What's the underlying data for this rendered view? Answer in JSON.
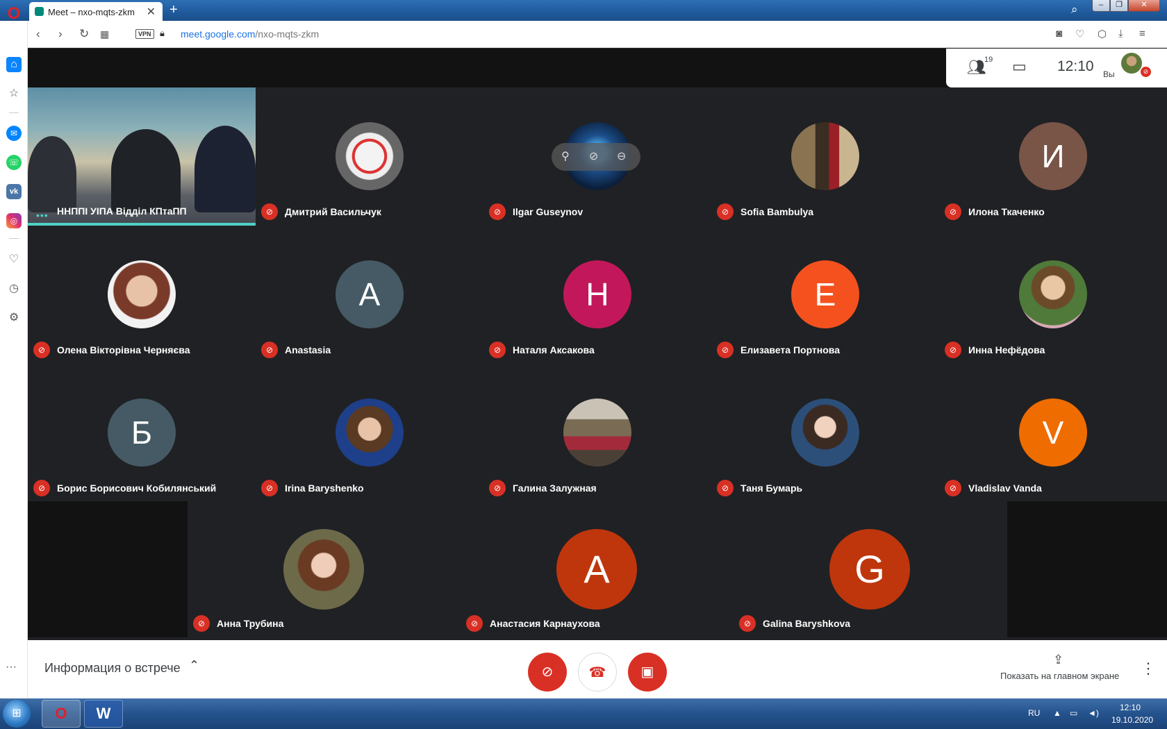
{
  "browser": {
    "tab_title": "Meet – nxo-mqts-zkm",
    "tab_close": "✕",
    "new_tab": "+",
    "url_host": "meet.google.com",
    "url_path": "/nxo-mqts-zkm",
    "vpn": "VPN"
  },
  "meet": {
    "people_count": "19",
    "clock": "12:10",
    "you_label": "Вы",
    "participants": [
      {
        "name": "ННППІ УІПА Відділ КПтаПП",
        "initial": "",
        "color": ""
      },
      {
        "name": "Дмитрий Васильчук",
        "initial": "",
        "color": ""
      },
      {
        "name": "Ilgar Guseynov",
        "initial": "",
        "color": ""
      },
      {
        "name": "Sofia Bambulya",
        "initial": "",
        "color": ""
      },
      {
        "name": "Илона Ткаченко",
        "initial": "И",
        "color": "#795548"
      },
      {
        "name": "Олена Вікторівна Черняєва",
        "initial": "",
        "color": ""
      },
      {
        "name": "Anastasia",
        "initial": "A",
        "color": "#455a64"
      },
      {
        "name": "Наталя Аксакова",
        "initial": "Н",
        "color": "#c2185b"
      },
      {
        "name": "Елизавета Портнова",
        "initial": "Е",
        "color": "#f4511e"
      },
      {
        "name": "Инна Нефёдова",
        "initial": "",
        "color": ""
      },
      {
        "name": "Борис Борисович Кобилянський",
        "initial": "Б",
        "color": "#455a64"
      },
      {
        "name": "Irina Baryshenko",
        "initial": "",
        "color": ""
      },
      {
        "name": "Галина Залужная",
        "initial": "",
        "color": ""
      },
      {
        "name": "Таня Бумарь",
        "initial": "",
        "color": ""
      },
      {
        "name": "Vladislav Vanda",
        "initial": "V",
        "color": "#ef6c00"
      },
      {
        "name": "Анна Трубина",
        "initial": "",
        "color": ""
      },
      {
        "name": "Анастасия Карнаухова",
        "initial": "A",
        "color": "#bf360c"
      },
      {
        "name": "Galina Baryshkova",
        "initial": "G",
        "color": "#bf360c"
      }
    ],
    "meeting_info_label": "Информация о встрече",
    "present_label": "Показать на главном экране"
  },
  "taskbar": {
    "lang": "RU",
    "time": "12:10",
    "date": "19.10.2020"
  },
  "icons": {
    "mic_muted": "mic-off-icon",
    "hangup": "call-end-icon",
    "camera_off": "videocam-off-icon",
    "people": "people-icon",
    "chat": "chat-icon"
  }
}
